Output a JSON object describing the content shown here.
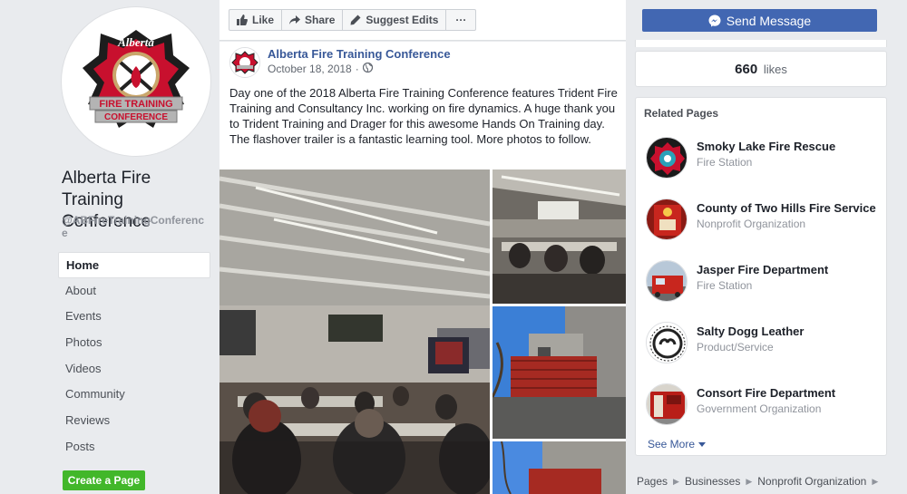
{
  "page": {
    "name": "Alberta Fire Training Conference",
    "handle": "@ABFireTrainingConference",
    "logo_text": {
      "top": "Alberta",
      "line1": "FIRE TRAINING",
      "line2": "CONFERENCE"
    }
  },
  "nav": {
    "items": [
      "Home",
      "About",
      "Events",
      "Photos",
      "Videos",
      "Community",
      "Reviews",
      "Posts"
    ],
    "active": "Home",
    "create_page": "Create a Page"
  },
  "actions": {
    "like": "Like",
    "share": "Share",
    "suggest": "Suggest Edits",
    "more": "···"
  },
  "post": {
    "author": "Alberta Fire Training Conference",
    "date": "October 18, 2018",
    "separator": "·",
    "text": "Day one of the 2018 Alberta Fire Training Conference features Trident Fire Training and Consultancy Inc. working on fire dynamics. A huge thank you to Trident Training and Drager for this awesome Hands On Training day. The flashover trailer is a fantastic learning tool. More photos to follow."
  },
  "sidebar": {
    "send_message": "Send Message",
    "likes_count": "660",
    "likes_label": "likes",
    "related_title": "Related Pages",
    "related": [
      {
        "name": "Smoky Lake Fire Rescue",
        "category": "Fire Station"
      },
      {
        "name": "County of Two Hills Fire Service",
        "category": "Nonprofit Organization"
      },
      {
        "name": "Jasper Fire Department",
        "category": "Fire Station"
      },
      {
        "name": "Salty Dogg Leather",
        "category": "Product/Service"
      },
      {
        "name": "Consort Fire Department",
        "category": "Government Organization"
      }
    ],
    "see_more": "See More"
  },
  "breadcrumbs": [
    "Pages",
    "Businesses",
    "Nonprofit Organization"
  ],
  "colors": {
    "brand_blue": "#4267b2",
    "link_blue": "#385898",
    "green": "#42b72a",
    "background": "#e9ebee"
  }
}
